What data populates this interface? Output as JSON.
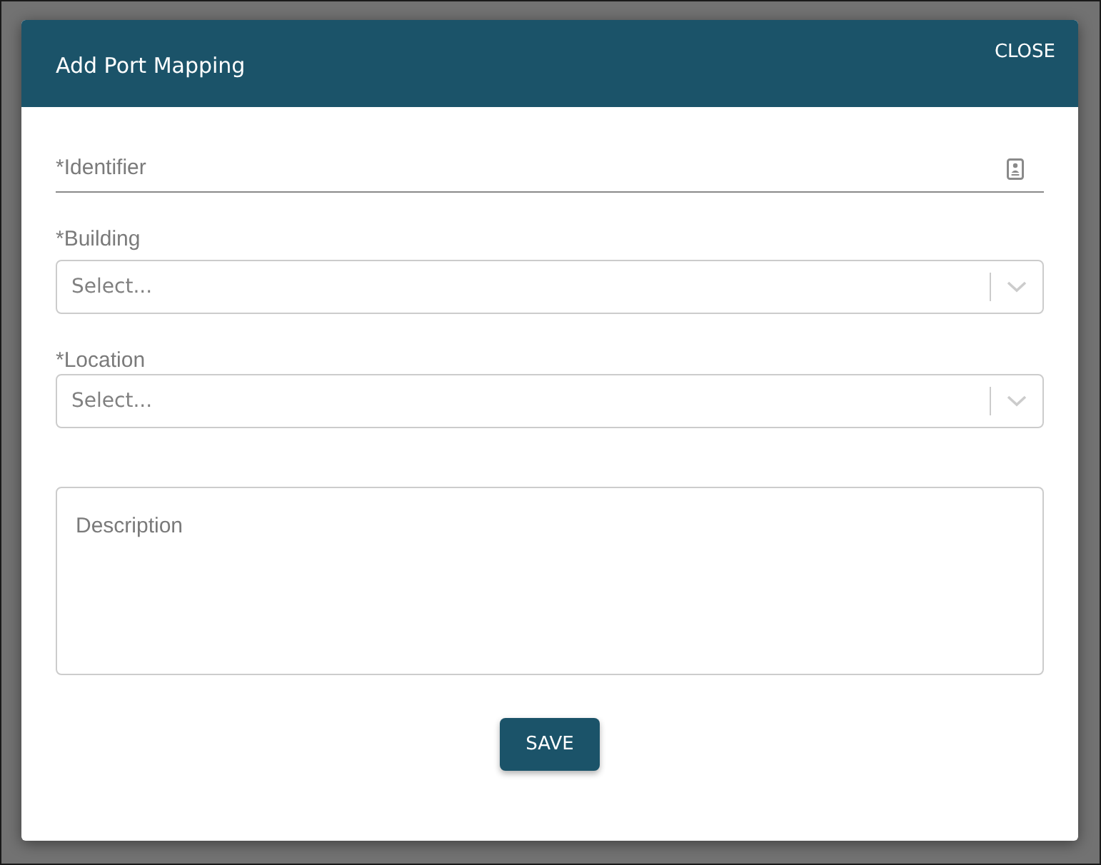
{
  "dialog": {
    "title": "Add Port Mapping",
    "close_label": "CLOSE"
  },
  "fields": [
    {
      "kind": "text",
      "label": "*Identifier"
    },
    {
      "kind": "select",
      "label": "*Building",
      "placeholder": "Select..."
    },
    {
      "kind": "select",
      "label": "*Location",
      "placeholder": "Select..."
    },
    {
      "kind": "textarea",
      "placeholder": "Description"
    }
  ],
  "save_label": "SAVE"
}
